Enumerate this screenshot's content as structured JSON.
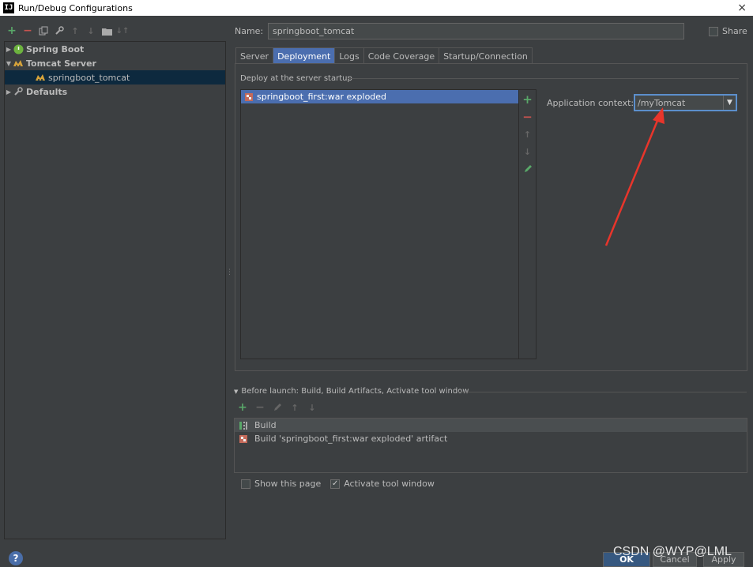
{
  "window": {
    "title": "Run/Debug Configurations",
    "close": "×",
    "app_icon": "IJ"
  },
  "toolbar": {
    "icons": [
      "plus-icon",
      "minus-icon",
      "copy-icon",
      "wrench-icon",
      "arrow-up-icon",
      "arrow-down-icon",
      "folder-icon",
      "sort-icon"
    ]
  },
  "tree": {
    "items": [
      {
        "label": "Spring Boot",
        "expanded": false,
        "bold": true
      },
      {
        "label": "Tomcat Server",
        "expanded": true,
        "bold": true
      },
      {
        "label": "springboot_tomcat",
        "selected": true
      },
      {
        "label": "Defaults",
        "expanded": false,
        "bold": true
      }
    ]
  },
  "config": {
    "name_label": "Name:",
    "name_value": "springboot_tomcat",
    "share_label": "Share",
    "share_checked": false
  },
  "tabs": [
    {
      "label": "Server",
      "active": false
    },
    {
      "label": "Deployment",
      "active": true
    },
    {
      "label": "Logs",
      "active": false
    },
    {
      "label": "Code Coverage",
      "active": false
    },
    {
      "label": "Startup/Connection",
      "active": false
    }
  ],
  "deployment": {
    "group_title": "Deploy at the server startup",
    "artifacts": [
      "springboot_first:war exploded"
    ],
    "context_label": "Application context:",
    "context_value": "/myTomcat"
  },
  "before_launch": {
    "header": "Before launch: Build, Build Artifacts, Activate tool window",
    "items": [
      "Build",
      "Build 'springboot_first:war exploded' artifact"
    ]
  },
  "options": {
    "show_page_label": "Show this page",
    "show_page_checked": false,
    "activate_label": "Activate tool window",
    "activate_checked": true
  },
  "footer": {
    "help": "?",
    "ok": "OK",
    "cancel": "Cancel",
    "apply": "Apply"
  },
  "watermark": "CSDN @WYP@LML",
  "colors": {
    "accent": "#4b6eaf",
    "add": "#59a869",
    "remove": "#c75450",
    "annotation": "#e8352b"
  }
}
